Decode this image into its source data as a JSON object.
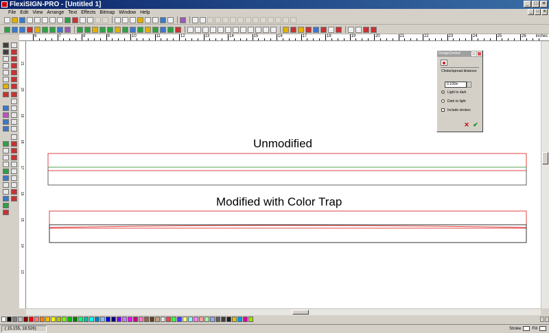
{
  "window": {
    "title": "FlexiSIGN-PRO - [Untitled 1]"
  },
  "window_buttons": {
    "minimize": "_",
    "maximize": "□",
    "close": "✕"
  },
  "menu": [
    "File",
    "Edit",
    "View",
    "Arrange",
    "Text",
    "Effects",
    "Bitmap",
    "Window",
    "Help"
  ],
  "ruler": {
    "units": "inches",
    "top_labels": [
      "6",
      "7",
      "8",
      "9",
      "10",
      "11",
      "12",
      "13",
      "14",
      "15",
      "16",
      "17",
      "18",
      "19",
      "20",
      "21",
      "22",
      "23",
      "24",
      "25",
      "26"
    ],
    "left_labels": [
      "21",
      "20",
      "19",
      "18",
      "17",
      "16",
      "15",
      "14",
      "13"
    ]
  },
  "canvas": {
    "heading1": "Unmodified",
    "heading2": "Modified with Color Trap"
  },
  "design_central": {
    "title": "DesignCentral",
    "field_label": "Choke/spread distance:",
    "distance_value": "0.100in",
    "option_light_to_dark": "Light to dark",
    "option_dark_to_light": "Dark to light",
    "include_strokes": "Include strokes",
    "cancel_symbol": "✕",
    "apply_symbol": "✔"
  },
  "palette_colors": [
    "#ffffff",
    "#000000",
    "#808080",
    "#c0c0c0",
    "#800000",
    "#ff0000",
    "#ff8080",
    "#ff8000",
    "#ffc000",
    "#ffff00",
    "#c0c000",
    "#80ff00",
    "#00c000",
    "#008000",
    "#00ff80",
    "#00c0a0",
    "#00ffff",
    "#0080c0",
    "#80c0ff",
    "#0000ff",
    "#000080",
    "#8000ff",
    "#c080ff",
    "#ff00ff",
    "#c00080",
    "#ff80c0",
    "#a06040",
    "#604020",
    "#c0a080",
    "#e0e0e0",
    "#ff4040",
    "#40ff40",
    "#4040ff",
    "#ffff80",
    "#80ffff",
    "#ff80ff",
    "#ffa0a0",
    "#a0ffa0",
    "#a0a0ff",
    "#606060",
    "#404040",
    "#202020",
    "#e0c000",
    "#00a0e0",
    "#e000a0",
    "#a0e000"
  ],
  "status": {
    "coords": "( 15.155,   18.526)",
    "stroke_label": "Stroke",
    "fill_label": "Fill"
  }
}
